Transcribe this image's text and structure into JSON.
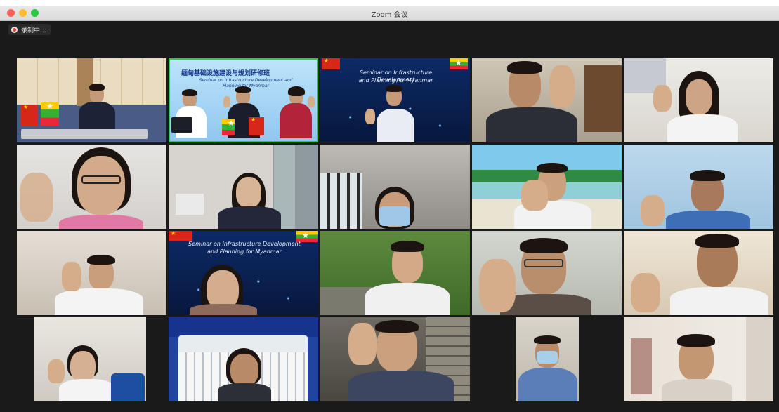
{
  "window": {
    "title": "Zoom 会议"
  },
  "recording": {
    "label": "录制中..."
  },
  "banner": {
    "cn_title": "缅甸基础设施建设与规划研修班",
    "en_title": "Seminar on Infrastructure Development and Planning for Myanmar",
    "en_line1": "Seminar on Infrastructure Development",
    "en_line2": "and Planning for Myanmar"
  },
  "colors": {
    "active_speaker": "#34c749",
    "background": "#1a1a1a",
    "titlebar": "#e0e0e0"
  },
  "grid": {
    "rows": 4,
    "columns": 5,
    "participant_count": 20
  }
}
